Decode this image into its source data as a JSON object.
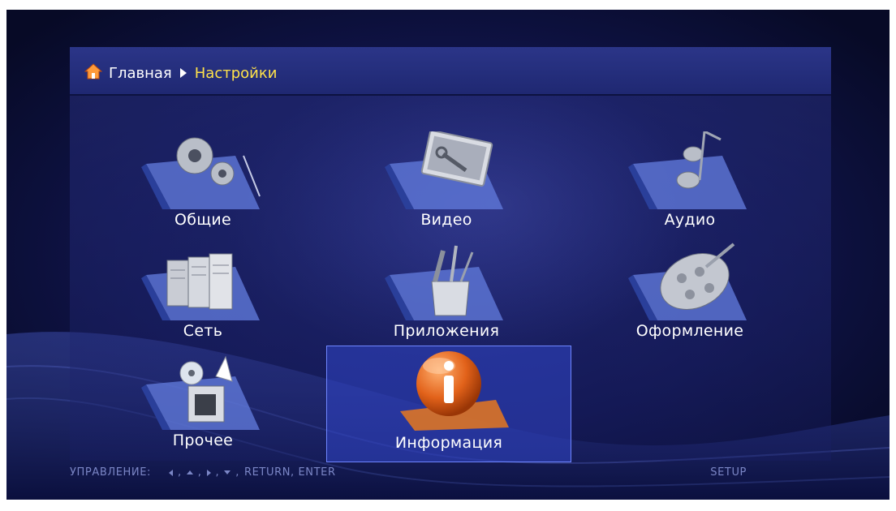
{
  "breadcrumb": {
    "home_label": "Главная",
    "current_label": "Настройки",
    "home_icon": "home-icon",
    "separator_icon": "triangle-right-icon"
  },
  "tiles": [
    {
      "label": "Общие",
      "icon": "gears-folder-icon",
      "selected": false
    },
    {
      "label": "Видео",
      "icon": "video-folder-icon",
      "selected": false
    },
    {
      "label": "Аудио",
      "icon": "audio-folder-icon",
      "selected": false
    },
    {
      "label": "Сеть",
      "icon": "network-folder-icon",
      "selected": false
    },
    {
      "label": "Приложения",
      "icon": "tools-folder-icon",
      "selected": false
    },
    {
      "label": "Оформление",
      "icon": "palette-folder-icon",
      "selected": false
    },
    {
      "label": "Прочее",
      "icon": "misc-folder-icon",
      "selected": false
    },
    {
      "label": "Информация",
      "icon": "info-icon",
      "selected": true
    }
  ],
  "footer": {
    "controls_label": "УПРАВЛЕНИЕ:",
    "sep": ",",
    "keys_text": "RETURN, ENTER",
    "right_label": "SETUP"
  },
  "colors": {
    "background": "#10144a",
    "header": "#2b3588",
    "current_crumb": "#ffe24a",
    "selection": "#3346c8",
    "footer_text": "#7b86c6",
    "info_orange": "#e8681f"
  }
}
